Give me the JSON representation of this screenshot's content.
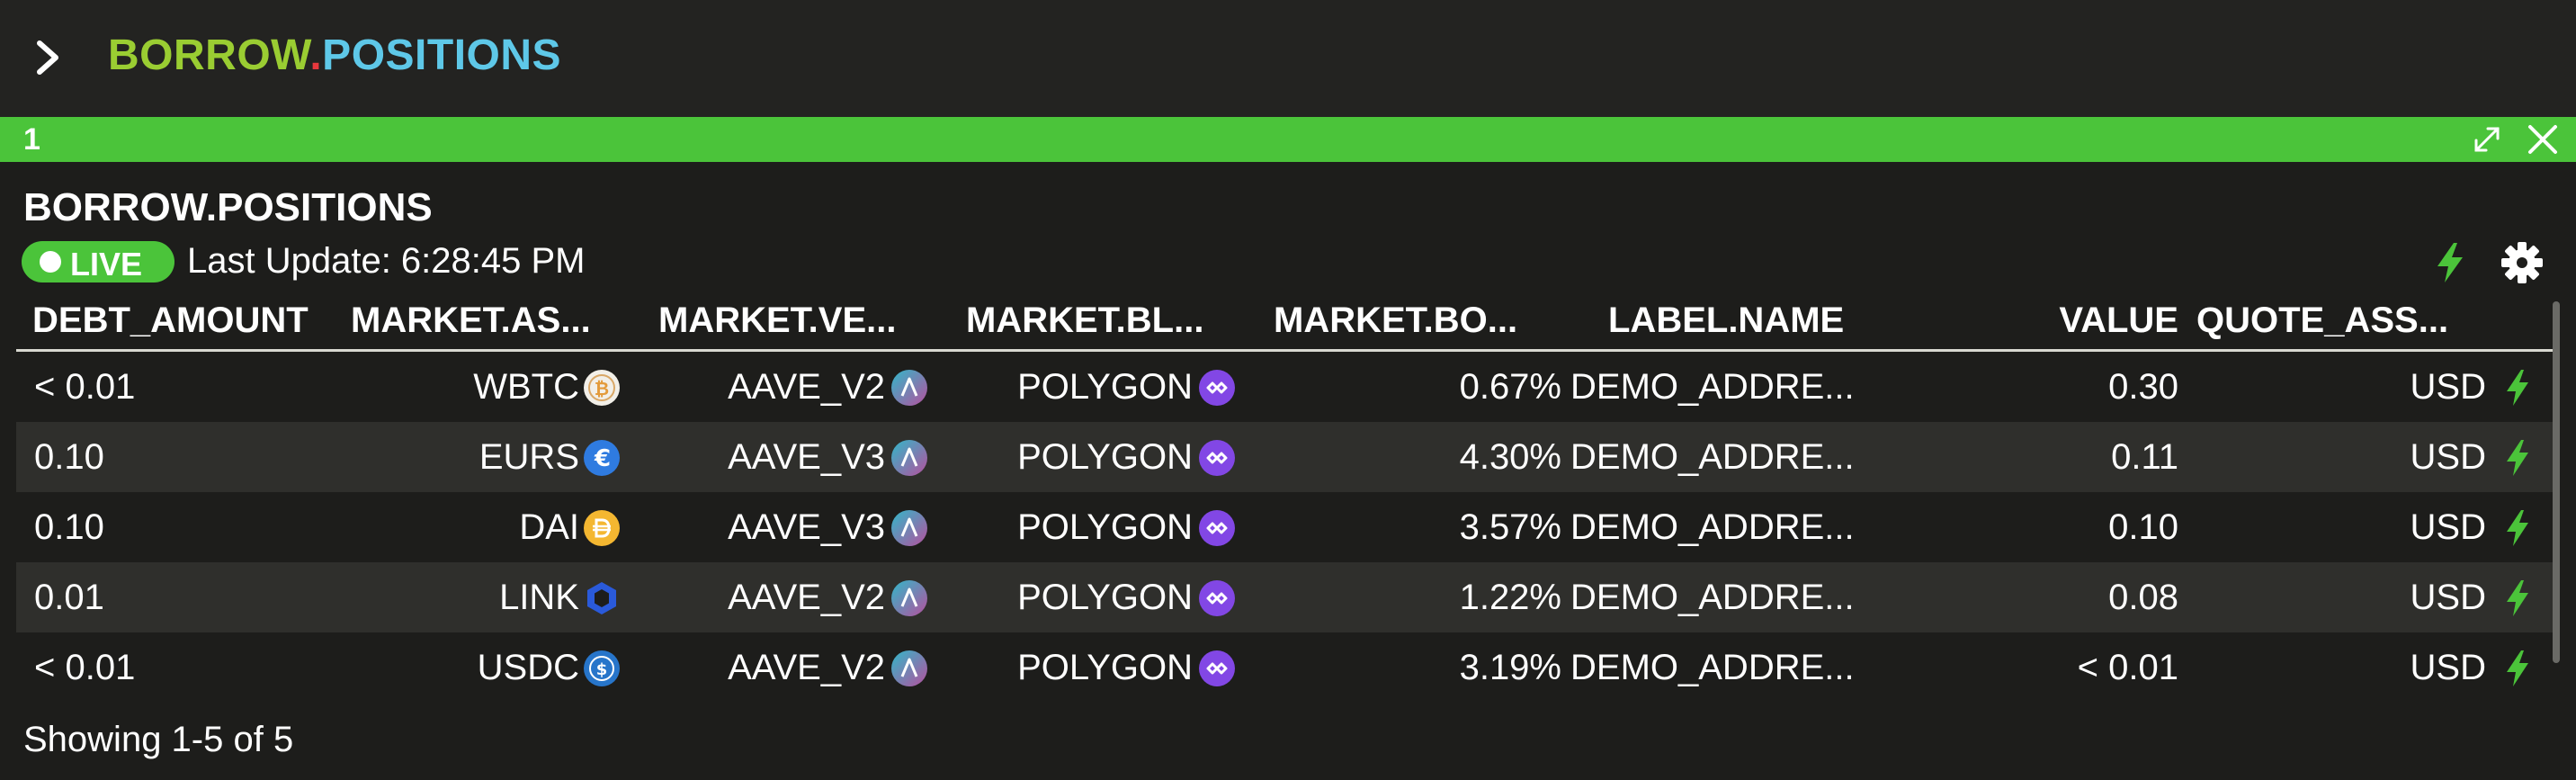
{
  "app": {
    "title_part1": "BORROW",
    "title_dot": ".",
    "title_part2": "POSITIONS"
  },
  "panel": {
    "number": "1"
  },
  "widget": {
    "title": "BORROW.POSITIONS",
    "live_label": "LIVE",
    "last_update": "Last Update: 6:28:45 PM"
  },
  "table": {
    "headers": {
      "debt_amount": "DEBT_AMOUNT",
      "market_asset": "MARKET.AS...",
      "market_venue": "MARKET.VE...",
      "market_blockchain": "MARKET.BL...",
      "market_borrow": "MARKET.BO...",
      "label_name": "LABEL.NAME",
      "value": "VALUE",
      "quote_asset": "QUOTE_ASS..."
    },
    "rows": [
      {
        "debt": "< 0.01",
        "asset": "WBTC",
        "venue": "AAVE_V2",
        "chain": "POLYGON",
        "rate": "0.67%",
        "label": "DEMO_ADDRE...",
        "value": "0.30",
        "quote": "USD"
      },
      {
        "debt": "0.10",
        "asset": "EURS",
        "venue": "AAVE_V3",
        "chain": "POLYGON",
        "rate": "4.30%",
        "label": "DEMO_ADDRE...",
        "value": "0.11",
        "quote": "USD"
      },
      {
        "debt": "0.10",
        "asset": "DAI",
        "venue": "AAVE_V3",
        "chain": "POLYGON",
        "rate": "3.57%",
        "label": "DEMO_ADDRE...",
        "value": "0.10",
        "quote": "USD"
      },
      {
        "debt": "0.01",
        "asset": "LINK",
        "venue": "AAVE_V2",
        "chain": "POLYGON",
        "rate": "1.22%",
        "label": "DEMO_ADDRE...",
        "value": "0.08",
        "quote": "USD"
      },
      {
        "debt": "< 0.01",
        "asset": "USDC",
        "venue": "AAVE_V2",
        "chain": "POLYGON",
        "rate": "3.19%",
        "label": "DEMO_ADDRE...",
        "value": "< 0.01",
        "quote": "USD"
      }
    ]
  },
  "footer": {
    "showing": "Showing 1-5 of 5"
  },
  "icons": {
    "menu": "chevron-right-icon",
    "expand": "expand-icon",
    "close": "close-icon",
    "bolt": "lightning-bolt-icon",
    "settings": "gear-icon",
    "coins": [
      "wbtc-coin-icon",
      "eurs-coin-icon",
      "dai-coin-icon",
      "link-coin-icon",
      "usdc-coin-icon"
    ],
    "venue": "aave-logo-icon",
    "chain": "polygon-logo-icon"
  },
  "colors": {
    "accent_green": "#4bc43a",
    "title_green": "#9acd32",
    "title_dot": "#e8383d",
    "title_blue": "#5ec8e8",
    "bolt_green": "#4bc43a",
    "background": "#1d1d1b",
    "row_alt": "#2f2f2c"
  }
}
